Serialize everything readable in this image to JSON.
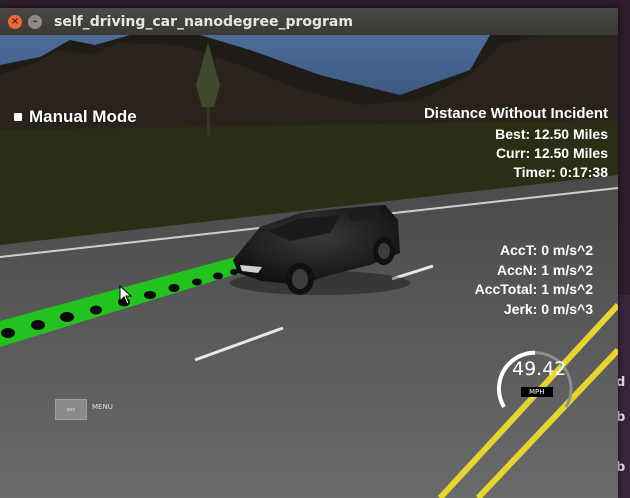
{
  "window": {
    "title": "self_driving_car_nanodegree_program"
  },
  "hud": {
    "mode": "Manual Mode",
    "distance_heading": "Distance Without Incident",
    "best": "Best: 12.50 Miles",
    "curr": "Curr: 12.50 Miles",
    "timer": "Timer: 0:17:38",
    "acc_t": "AccT: 0 m/s^2",
    "acc_n": "AccN: 1 m/s^2",
    "acc_total": "AccTotal: 1 m/s^2",
    "jerk": "Jerk: 0 m/s^3"
  },
  "speedometer": {
    "value": "49.42",
    "unit": "MPH",
    "fraction": 0.5
  },
  "menu": {
    "esc_label": "esc",
    "menu_label": "MENU"
  },
  "desktop": {
    "fragments": [
      "d",
      "b",
      "b"
    ]
  },
  "colors": {
    "path": "#22c21f",
    "sky": "#3f5f88",
    "grass": "#2a2c12",
    "road": "#5b5b5b",
    "lane_yellow": "#e6d431"
  },
  "icons": [
    "close-icon",
    "minimize-icon",
    "mouse-cursor-icon"
  ]
}
